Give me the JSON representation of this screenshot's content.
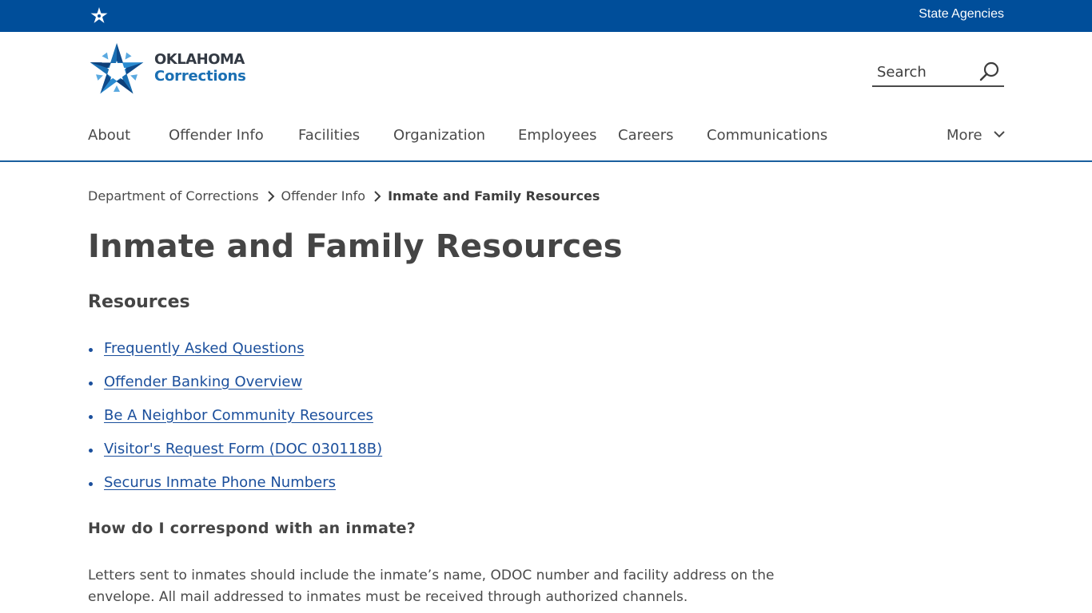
{
  "topbar": {
    "agencies_label": "State Agencies",
    "color": "#004e9a"
  },
  "logo": {
    "line1": "OKLAHOMA",
    "line2": "Corrections",
    "icon": "oklahoma-star-icon"
  },
  "search": {
    "placeholder": "Search",
    "icon": "search-icon"
  },
  "nav": {
    "items": [
      "About",
      "Offender Info",
      "Facilities",
      "Organization",
      "Employees",
      "Careers",
      "Communications"
    ],
    "more_label": "More"
  },
  "breadcrumb": {
    "items": [
      "Department of Corrections",
      "Offender Info"
    ],
    "current": "Inmate and Family Resources"
  },
  "page": {
    "title": "Inmate and Family Resources",
    "section_heading": "Resources",
    "links": [
      "Frequently Asked Questions",
      "Offender Banking Overview",
      "Be A Neighbor Community Resources",
      "Visitor's Request Form (DOC 030118B)",
      "Securus Inmate Phone Numbers"
    ],
    "subheading": "How do I correspond with an inmate?",
    "paragraph": "Letters sent to inmates should include the inmate’s name, ODOC number and facility address on the envelope. All mail addressed to inmates must be received through authorized channels."
  },
  "colors": {
    "link": "#1b4f9c",
    "brand_blue": "#004e9a",
    "accent": "#1a6fb3",
    "text": "#3d3d3d"
  }
}
